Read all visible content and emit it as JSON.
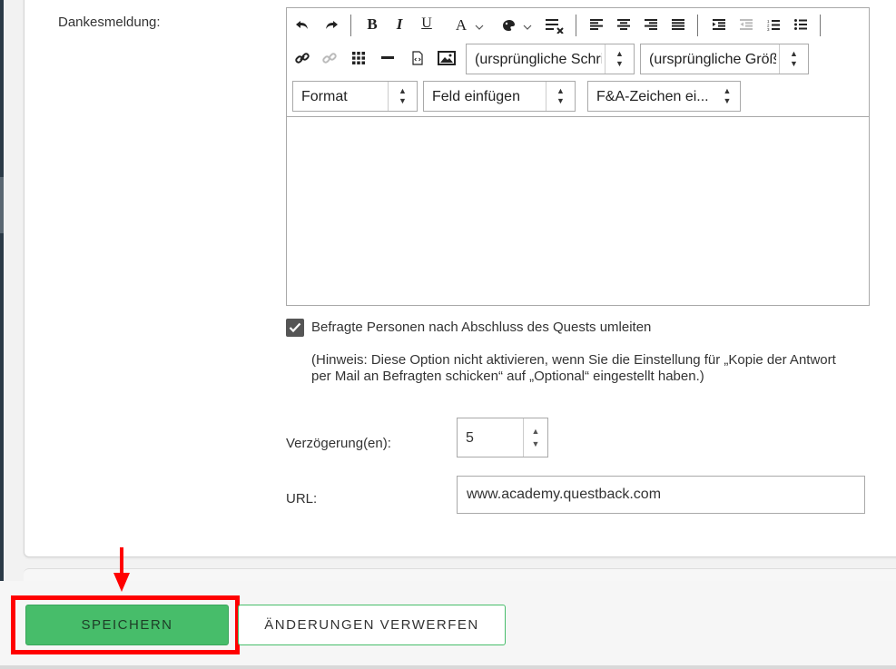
{
  "form": {
    "thanks_label": "Dankesmeldung:",
    "editor": {
      "toolbar": {
        "bold": "B",
        "italic": "I",
        "underline": "U",
        "font_color": "A",
        "font_select": "(ursprüngliche Schriftart)",
        "size_select": "(ursprüngliche Größe)",
        "format_select": "Format",
        "insert_field_select": "Feld einfügen",
        "qa_select": "F&A-Zeichen ei..."
      },
      "content": ""
    },
    "redirect_label": "Befragte Personen nach Abschluss des Quests umleiten",
    "redirect_checked": true,
    "hint": "(Hinweis: Diese Option nicht aktivieren, wenn Sie die Einstellung für „Kopie der Antwort per Mail an Befragten schicken“ auf „Optional“ eingestellt haben.)",
    "delay_label": "Verzögerung(en):",
    "delay_value": "5",
    "url_label": "URL:",
    "url_value": "www.academy.questback.com"
  },
  "footer": {
    "save_label": "SPEICHERN",
    "discard_label": "ÄNDERUNGEN VERWERFEN"
  },
  "colors": {
    "save_green": "#47bd6a",
    "annotation_red": "#ff0000"
  }
}
